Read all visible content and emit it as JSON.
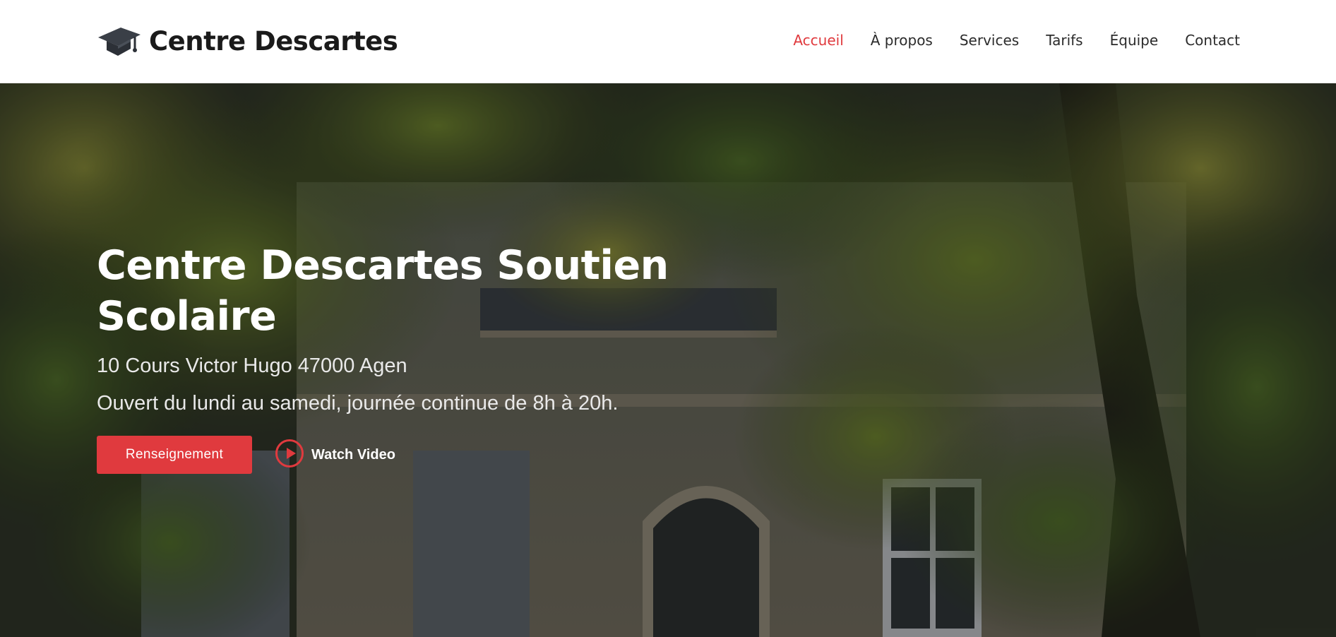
{
  "header": {
    "brand": {
      "name": "Centre Descartes",
      "icon": "graduation-cap-icon"
    },
    "nav": [
      {
        "label": "Accueil",
        "active": true
      },
      {
        "label": "À propos",
        "active": false
      },
      {
        "label": "Services",
        "active": false
      },
      {
        "label": "Tarifs",
        "active": false
      },
      {
        "label": "Équipe",
        "active": false
      },
      {
        "label": "Contact",
        "active": false
      }
    ]
  },
  "hero": {
    "title": "Centre Descartes Soutien Scolaire",
    "address": "10 Cours Victor Hugo 47000 Agen",
    "hours": "Ouvert du lundi au samedi, journée continue de 8h à 20h.",
    "primary_button": "Renseignement",
    "video_link": {
      "label": "Watch Video",
      "icon": "play-circle-icon"
    }
  },
  "colors": {
    "accent": "#e03a3e",
    "header_bg": "#ffffff",
    "nav_text": "#2b2b2b",
    "hero_text": "#ffffff"
  }
}
